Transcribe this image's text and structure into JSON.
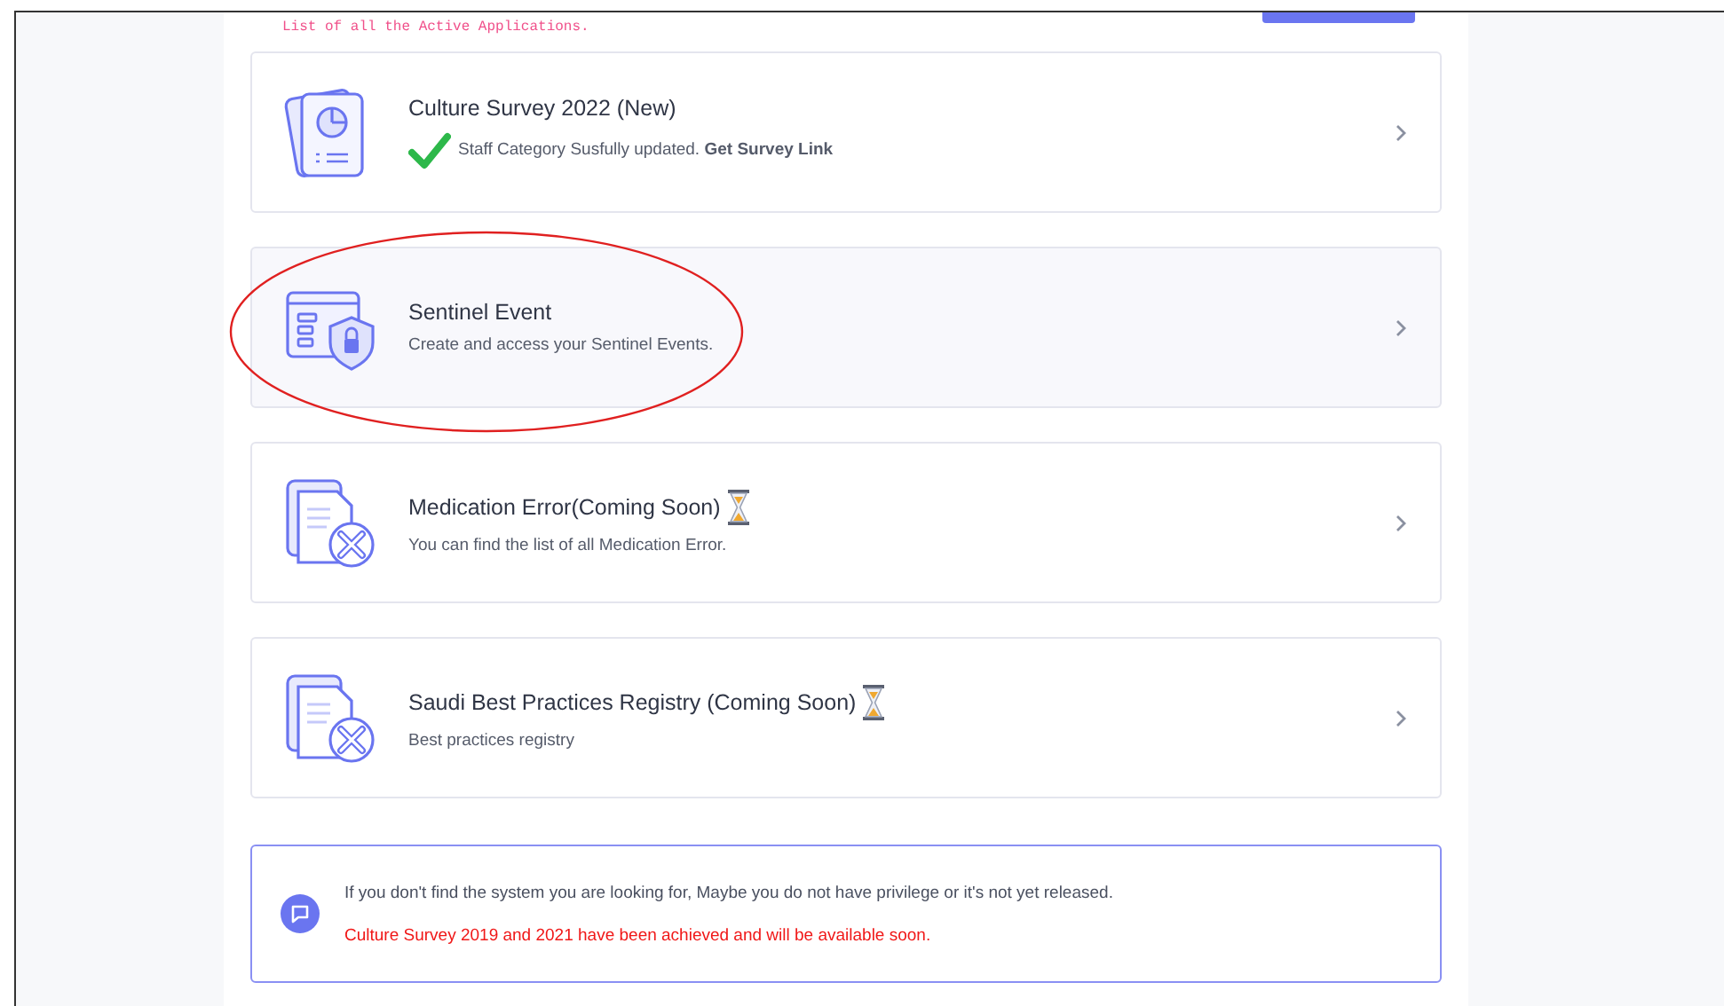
{
  "header": {
    "subtitle": "List of all the Active Applications."
  },
  "applications": [
    {
      "kind": "survey",
      "title": "Culture Survey 2022 (New)",
      "description": "Staff Category Susfully updated. **Get Survey Link**",
      "success": true,
      "coming_soon": false,
      "highlighted": false
    },
    {
      "kind": "sentinel",
      "title": "Sentinel Event",
      "description": "Create and access your Sentinel Events.",
      "success": false,
      "coming_soon": false,
      "highlighted": true
    },
    {
      "kind": "medication",
      "title": "Medication Error(Coming Soon)",
      "description": "You can find the list of all Medication Error.",
      "success": false,
      "coming_soon": true,
      "highlighted": false
    },
    {
      "kind": "medication",
      "title": "Saudi Best Practices Registry (Coming Soon)",
      "description": "Best practices registry",
      "success": false,
      "coming_soon": true,
      "highlighted": false
    }
  ],
  "notice": {
    "message": "If you don't find the system you are looking for, Maybe you do not have privilege or it's not yet released.",
    "warning": "Culture Survey 2019 and 2021 have been achieved and will be available soon."
  }
}
